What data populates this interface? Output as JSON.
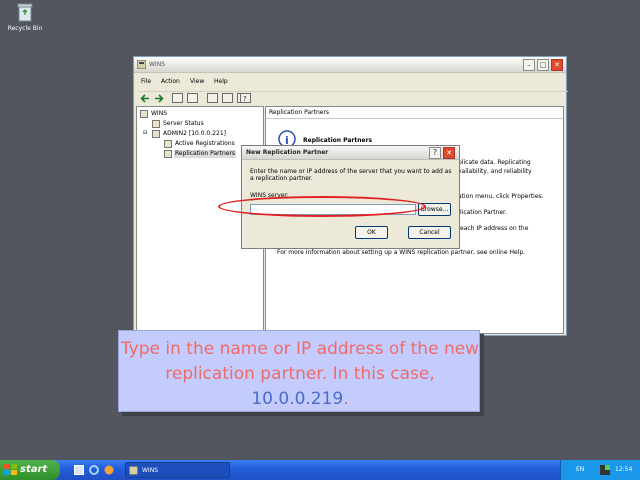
{
  "desktop": {
    "recycle_bin_label": "Recycle Bin"
  },
  "wins_window": {
    "title": "WINS",
    "menu": [
      "File",
      "Action",
      "View",
      "Help"
    ],
    "tree": {
      "root": "WINS",
      "server_status": "Server Status",
      "server": "ADMIN2 [10.0.0.221]",
      "active_registrations": "Active Registrations",
      "replication_partners": "Replication Partners"
    },
    "right_header": "Replication Partners",
    "right_heading": "Replication Partners",
    "right_lines": [
      "plicate data. Replicating",
      "vailability, and reliability",
      "ation menu, click Properties.",
      "lication Partner.",
      "each IP address on the"
    ],
    "right_footer": "For more information about setting up a WINS replication partner, see online Help."
  },
  "dialog": {
    "title": "New Replication Partner",
    "help_glyph": "?",
    "close_glyph": "✕",
    "description": "Enter the name or IP address of the server that you want to add as a replication partner.",
    "wins_server_label": "WINS server:",
    "wins_server_value": "",
    "browse_label": "Browse...",
    "ok_label": "OK",
    "cancel_label": "Cancel"
  },
  "callout": {
    "text_before": "Type in the name or IP address of the new replication partner. In this case, ",
    "ip": "10.0.0.219",
    "text_after": "."
  },
  "taskbar": {
    "start_label": "start",
    "task_label": "WINS",
    "language": "EN",
    "clock": "12:54"
  },
  "colors": {
    "desktop": "#53565e",
    "callout_bg": "#c3ccfc",
    "callout_text": "#f06a6a",
    "callout_ip": "#4a6bc8",
    "highlight_ellipse": "#e02020"
  }
}
